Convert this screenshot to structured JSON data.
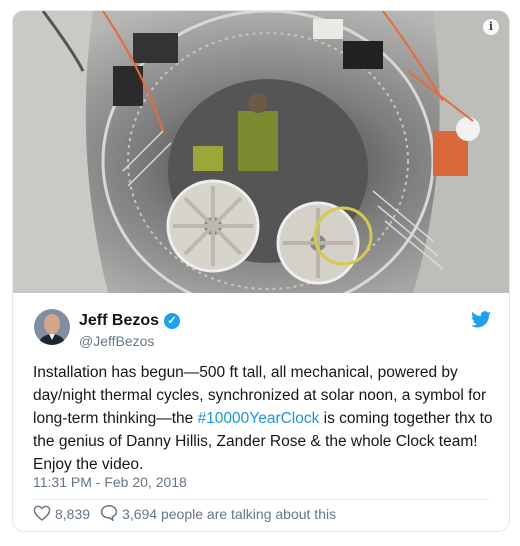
{
  "media": {
    "info_icon": "info-icon",
    "info_glyph": "i"
  },
  "author": {
    "name": "Jeff Bezos",
    "handle": "@JeffBezos",
    "verified_icon": "verified-badge-icon",
    "verified_glyph": "✓"
  },
  "brand": {
    "icon": "twitter-bird-icon",
    "color": "#1da1f2"
  },
  "tweet": {
    "text_before": "Installation has begun—500 ft tall, all mechanical, powered by day/night thermal cycles, synchronized at solar noon, a symbol for long-term thinking—the ",
    "hashtag": "#10000YearClock",
    "text_after": " is coming together thx to the genius of Danny Hillis, Zander Rose & the whole Clock team! Enjoy the video.",
    "timestamp": "11:31 PM - Feb 20, 2018"
  },
  "engagement": {
    "likes": "8,839",
    "talking": "3,694 people are talking about this",
    "like_icon": "heart-icon",
    "talk_icon": "comment-icon"
  },
  "colors": {
    "hashtag": "#1b95e0",
    "secondary_text": "#657786",
    "border": "#e1e8ed"
  }
}
